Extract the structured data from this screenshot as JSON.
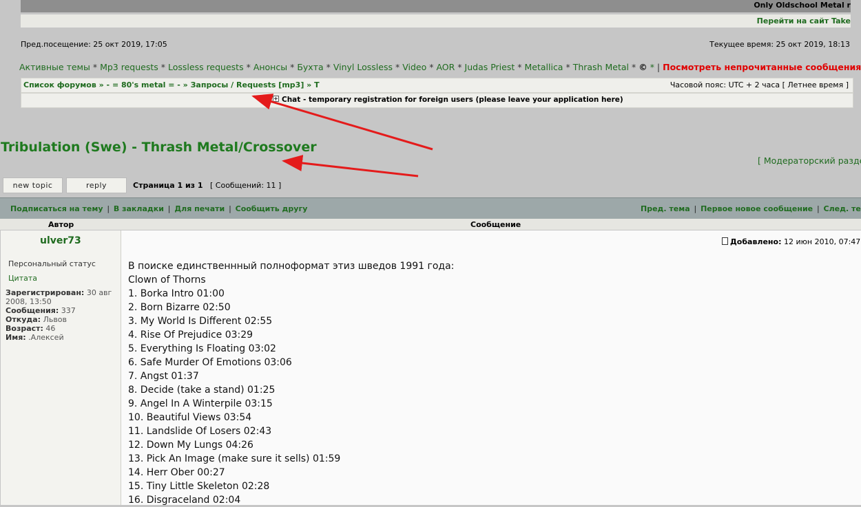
{
  "header": {
    "site_slogan": "Only Oldschool Metal r",
    "goto_site": "Перейти на сайт Take",
    "last_visit": "Пред.посещение: 25 окт 2019, 17:05",
    "current_time": "Текущее время: 25 окт 2019, 18:13"
  },
  "nav": {
    "items": [
      "Активные темы",
      "Mp3 requests",
      "Lossless requests",
      "Анонсы",
      "Бухта",
      "Vinyl Lossless",
      "Video",
      "AOR",
      "Judas Priest",
      "Metallica",
      "Thrash Metal"
    ],
    "sep": "*",
    "copyright": "©",
    "tail_star": "*",
    "bar": "|",
    "unread": "Посмотреть непрочитанные сообщения"
  },
  "breadcrumb": {
    "text": "Список форумов » - = 80's metal = - » Запросы / Requests [mp3] » T",
    "timezone": "Часовой пояс: UTC + 2 часа [ Летнее время ]"
  },
  "chat": {
    "title": "Chat",
    "desc": " - temporary registration for foreign users (please leave your application here)"
  },
  "topic": {
    "title": "Tribulation (Swe) - Thrash Metal/Crossover",
    "moderator": "[ Модераторский раздел",
    "new_topic": "new topic",
    "reply": "reply",
    "page": "Страница 1 из 1",
    "messages": "[ Сообщений: 11 ]"
  },
  "actions": {
    "left": [
      "Подписаться на тему",
      "В закладки",
      "Для печати",
      "Сообщить другу"
    ],
    "right": [
      "Пред. тема",
      "Первое новое сообщение",
      "След. тем"
    ],
    "sep": "|"
  },
  "table": {
    "author_header": "Автор",
    "message_header": "Сообщение"
  },
  "post": {
    "author": "ulver73",
    "status": "Персональный статус",
    "quote": "Цитата",
    "registered_label": "Зарегистрирован:",
    "registered_value": " 30 авг 2008, 13:50",
    "posts_label": "Сообщения:",
    "posts_value": " 337",
    "from_label": "Откуда:",
    "from_value": " Львов",
    "age_label": "Возраст:",
    "age_value": " 46",
    "name_label": "Имя:",
    "name_value": " .Алексей",
    "added_label": "Добавлено:",
    "added_value": " 12 июн 2010, 07:47",
    "lines": [
      "В поиске единственнный полноформат этиз шведов 1991 года:",
      "Clown of Thorns",
      "1. Borka Intro 01:00",
      "2. Born Bizarre 02:50",
      "3. My World Is Different 02:55",
      "4. Rise Of Prejudice 03:29",
      "5. Everything Is Floating 03:02",
      "6. Safe Murder Of Emotions 03:06",
      "7. Angst 01:37",
      "8. Decide (take a stand) 01:25",
      "9. Angel In A Winterpile 03:15",
      "10. Beautiful Views 03:54",
      "11. Landslide Of Losers 02:43",
      "12. Down My Lungs 04:26",
      "13. Pick An Image (make sure it sells) 01:59",
      "14. Herr Ober 00:27",
      "15. Tiny Little Skeleton 02:28",
      "16. Disgraceland 02:04"
    ]
  },
  "colors": {
    "link_green": "#1f6b1f",
    "unread_red": "#e00000",
    "arrow_red": "#e41b1b"
  }
}
